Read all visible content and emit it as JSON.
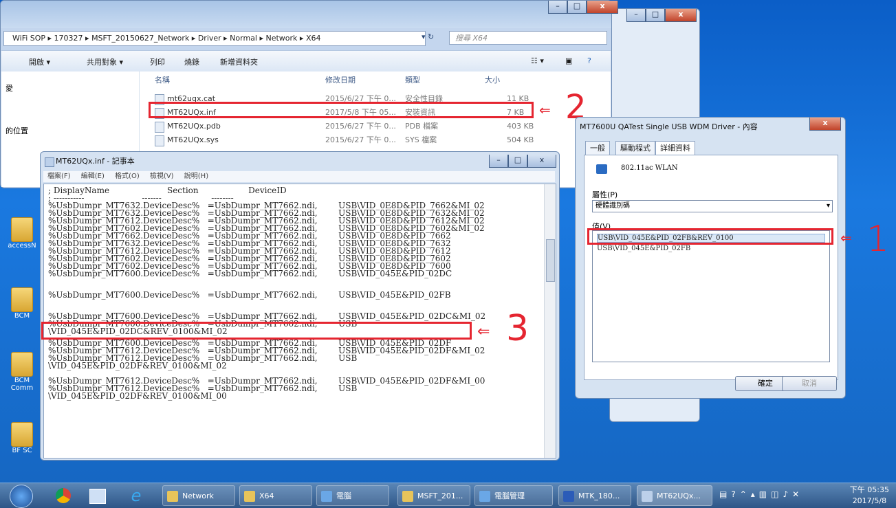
{
  "desktop": {
    "icons": [
      "accessN",
      "BCM",
      "BCM\nComm",
      "BF SC"
    ]
  },
  "explorer": {
    "address": "WiFi SOP ▸ 170327 ▸ MSFT_20150627_Network ▸ Driver ▸ Normal ▸ Network ▸ X64",
    "search_placeholder": "搜尋 X64",
    "toolbar": {
      "open": "開啟 ▾",
      "share": "共用對象 ▾",
      "print": "列印",
      "burn": "燒錄",
      "new_folder": "新增資料夾"
    },
    "nav": {
      "item1": "愛",
      "item2": "的位置"
    },
    "columns": {
      "name": "名稱",
      "date": "修改日期",
      "type": "類型",
      "size": "大小"
    },
    "files": [
      {
        "name": "mt62uqx.cat",
        "date": "2015/6/27 下午 0...",
        "type": "安全性目錄",
        "size": "11 KB"
      },
      {
        "name": "MT62UQx.inf",
        "date": "2017/5/8 下午 05...",
        "type": "安裝資訊",
        "size": "7 KB"
      },
      {
        "name": "MT62UQx.pdb",
        "date": "2015/6/27 下午 0...",
        "type": "PDB 檔案",
        "size": "403 KB"
      },
      {
        "name": "MT62UQx.sys",
        "date": "2015/6/27 下午 0...",
        "type": "SYS 檔案",
        "size": "504 KB"
      }
    ]
  },
  "notepad": {
    "title": "MT62UQx.inf - 記事本",
    "menu": [
      "檔案(F)",
      "編輯(E)",
      "格式(O)",
      "檢視(V)",
      "說明(H)"
    ],
    "lines": [
      "; DisplayName                      Section                   DeviceID",
      "; -----------                      -------                   --------",
      "%UsbDumpr_MT7632.DeviceDesc%   =UsbDumpr_MT7662.ndi,        USB\\VID_0E8D&PID_7662&MI_02",
      "%UsbDumpr_MT7632.DeviceDesc%   =UsbDumpr_MT7662.ndi,        USB\\VID_0E8D&PID_7632&MI_02",
      "%UsbDumpr_MT7612.DeviceDesc%   =UsbDumpr_MT7662.ndi,        USB\\VID_0E8D&PID_7612&MI_02",
      "%UsbDumpr_MT7602.DeviceDesc%   =UsbDumpr_MT7662.ndi,        USB\\VID_0E8D&PID_7602&MI_02",
      "%UsbDumpr_MT7662.DeviceDesc%   =UsbDumpr_MT7662.ndi,        USB\\VID_0E8D&PID_7662",
      "%UsbDumpr_MT7632.DeviceDesc%   =UsbDumpr_MT7662.ndi,        USB\\VID_0E8D&PID_7632",
      "%UsbDumpr_MT7612.DeviceDesc%   =UsbDumpr_MT7662.ndi,        USB\\VID_0E8D&PID_7612",
      "%UsbDumpr_MT7602.DeviceDesc%   =UsbDumpr_MT7662.ndi,        USB\\VID_0E8D&PID_7602",
      "%UsbDumpr_MT7602.DeviceDesc%   =UsbDumpr_MT7662.ndi,        USB\\VID_0E8D&PID_7600",
      "%UsbDumpr_MT7600.DeviceDesc%   =UsbDumpr_MT7662.ndi,        USB\\VID_045E&PID_02DC"
    ],
    "highlight_line": "%UsbDumpr_MT7600.DeviceDesc%   =UsbDumpr_MT7662.ndi,        USB\\VID_045E&PID_02FB",
    "lines2": [
      "%UsbDumpr_MT7600.DeviceDesc%   =UsbDumpr_MT7662.ndi,        USB\\VID_045E&PID_02DC&MI_02",
      "%UsbDumpr_MT7600.DeviceDesc%   =UsbDumpr_MT7662.ndi,        USB",
      "\\VID_045E&PID_02DC&REV_0100&MI_02",
      "%UsbDumpr_MT7600.DeviceDesc%   =UsbDumpr_MT7662.ndi,        USB\\VID_045E&PID_02DF",
      "%UsbDumpr_MT7612.DeviceDesc%   =UsbDumpr_MT7662.ndi,        USB\\VID_045E&PID_02DF&MI_02",
      "%UsbDumpr_MT7612.DeviceDesc%   =UsbDumpr_MT7662.ndi,        USB",
      "\\VID_045E&PID_02DF&REV_0100&MI_02",
      "%UsbDumpr_MT7612.DeviceDesc%   =UsbDumpr_MT7662.ndi,        USB\\VID_045E&PID_02DF&MI_00",
      "%UsbDumpr_MT7612.DeviceDesc%   =UsbDumpr_MT7662.ndi,        USB",
      "\\VID_045E&PID_02DF&REV_0100&MI_00"
    ]
  },
  "props": {
    "title": "MT7600U QATest Single USB WDM Driver - 內容",
    "tabs": [
      "一般",
      "驅動程式",
      "詳細資料"
    ],
    "device": "802.11ac WLAN",
    "property_label": "屬性(P)",
    "property_value": "硬體識別碼",
    "value_label": "值(V)",
    "values": [
      "USB\\VID_045E&PID_02FB&REV_0100",
      "USB\\VID_045E&PID_02FB"
    ],
    "ok": "確定",
    "cancel": "取消"
  },
  "annotations": {
    "one": "1",
    "two": "2",
    "three": "3"
  },
  "taskbar": {
    "items": [
      "Network",
      "X64",
      "電腦",
      "MSFT_201...",
      "電腦管理",
      "MTK_180...",
      "MT62UQx..."
    ],
    "time": "下午 05:35",
    "date": "2017/5/8"
  },
  "colors": {
    "highlight": "#e52530",
    "taskbar": "#2e5687"
  }
}
